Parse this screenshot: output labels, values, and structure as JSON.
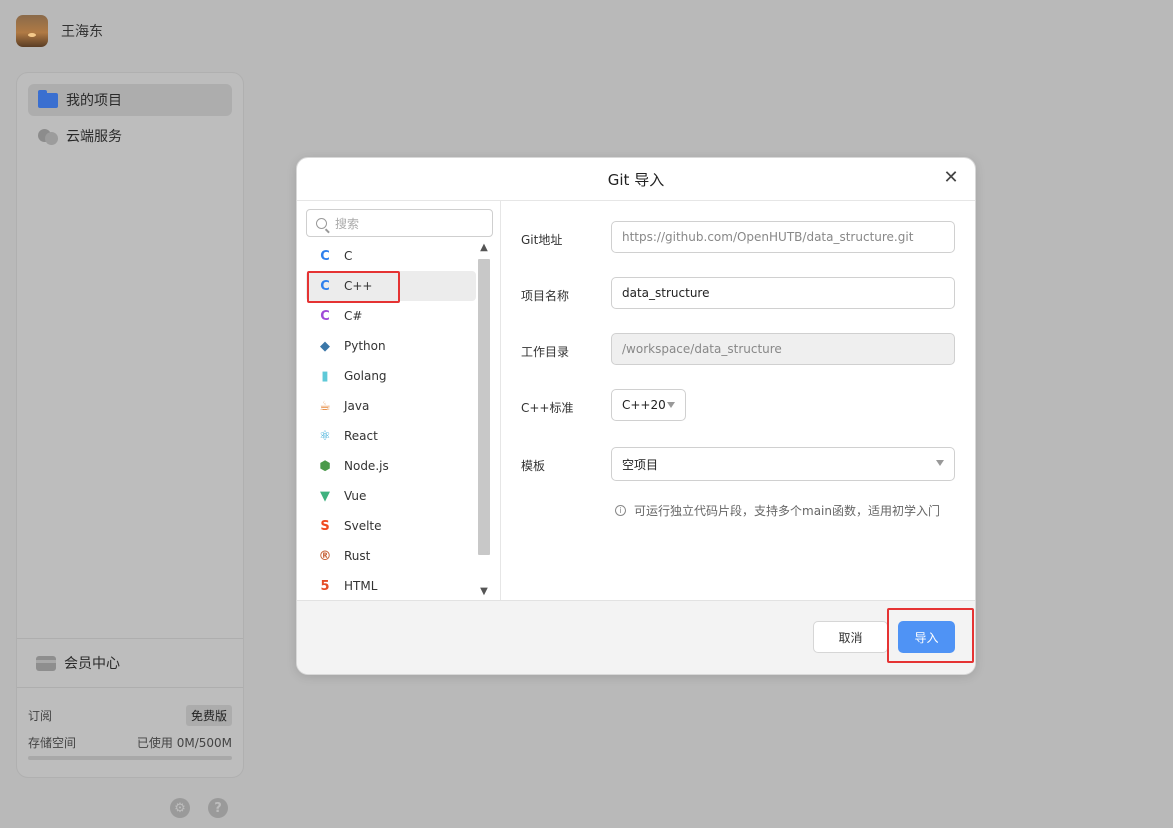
{
  "user": {
    "name": "王海东"
  },
  "sidebar": {
    "items": [
      {
        "label": "我的项目",
        "icon": "folder-icon",
        "active": true
      },
      {
        "label": "云端服务",
        "icon": "cloud-icon",
        "active": false
      }
    ],
    "member_center": "会员中心",
    "subscription_label": "订阅",
    "subscription_value": "免费版",
    "storage_label": "存储空间",
    "storage_used_prefix": "已使用",
    "storage_value": "0M/500M",
    "storage_fraction": 0.0
  },
  "dialog": {
    "title": "Git 导入",
    "search_placeholder": "搜索",
    "languages": [
      {
        "label": "C",
        "icon": "c-icon",
        "color": "#2f80ed"
      },
      {
        "label": "C++",
        "icon": "cpp-icon",
        "color": "#2f80ed",
        "selected": true
      },
      {
        "label": "C#",
        "icon": "csharp-icon",
        "color": "#a04ad8"
      },
      {
        "label": "Python",
        "icon": "python-icon",
        "color": "#3b77a8"
      },
      {
        "label": "Golang",
        "icon": "golang-icon",
        "color": "#5ec9d8"
      },
      {
        "label": "Java",
        "icon": "java-icon",
        "color": "#e2771f"
      },
      {
        "label": "React",
        "icon": "react-icon",
        "color": "#2aa6d6"
      },
      {
        "label": "Node.js",
        "icon": "nodejs-icon",
        "color": "#4a9a4a"
      },
      {
        "label": "Vue",
        "icon": "vue-icon",
        "color": "#3fb27f"
      },
      {
        "label": "Svelte",
        "icon": "svelte-icon",
        "color": "#f04a1f"
      },
      {
        "label": "Rust",
        "icon": "rust-icon",
        "color": "#c8633a"
      },
      {
        "label": "HTML",
        "icon": "html-icon",
        "color": "#e44d26"
      }
    ],
    "form": {
      "git_url_label": "Git地址",
      "git_url_value": "https://github.com/OpenHUTB/data_structure.git",
      "project_name_label": "项目名称",
      "project_name_value": "data_structure",
      "work_dir_label": "工作目录",
      "work_dir_value": "/workspace/data_structure",
      "cpp_std_label": "C++标准",
      "cpp_std_value": "C++20",
      "template_label": "模板",
      "template_value": "空项目",
      "hint": "可运行独立代码片段，支持多个main函数，适用初学入门"
    },
    "cancel_label": "取消",
    "import_label": "导入"
  }
}
